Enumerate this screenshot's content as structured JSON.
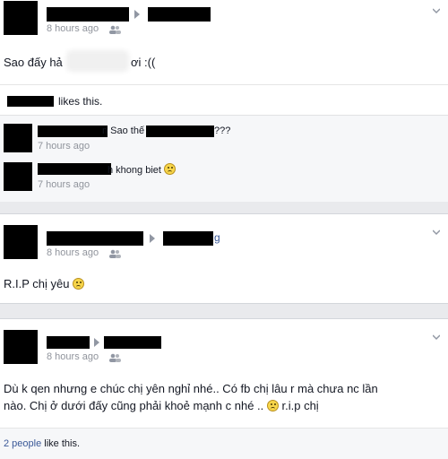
{
  "post1": {
    "time": "8 hours ago",
    "message_prefix": "Sao đấy hả",
    "message_suffix": "ơi :((",
    "likes_text": "likes this.",
    "comments": [
      {
        "text_prefix": "n Sao thế b",
        "text_suffix": "???",
        "time": "7 hours ago"
      },
      {
        "text": "h khong biet",
        "time": "7 hours ago"
      }
    ]
  },
  "post2": {
    "time": "8 hours ago",
    "target_fragment": "g",
    "message": "R.I.P chị yêu"
  },
  "post3": {
    "time": "8 hours ago",
    "message_line1": "Dù k qen nhưng e chúc chị yên nghỉ nhé.. Có fb chị lâu r mà chưa nc lần",
    "message_line2_prefix": "nào. Chị ở dưới đấy cũng phải khoẻ mạnh c nhé ..",
    "message_line2_suffix": "r.i.p chị",
    "likes_count": "2 people",
    "likes_suffix": "like this."
  },
  "icons": {
    "audience": "friends-icon",
    "chevron": "chevron-down-icon",
    "emoji": "frown-emoji-icon"
  }
}
